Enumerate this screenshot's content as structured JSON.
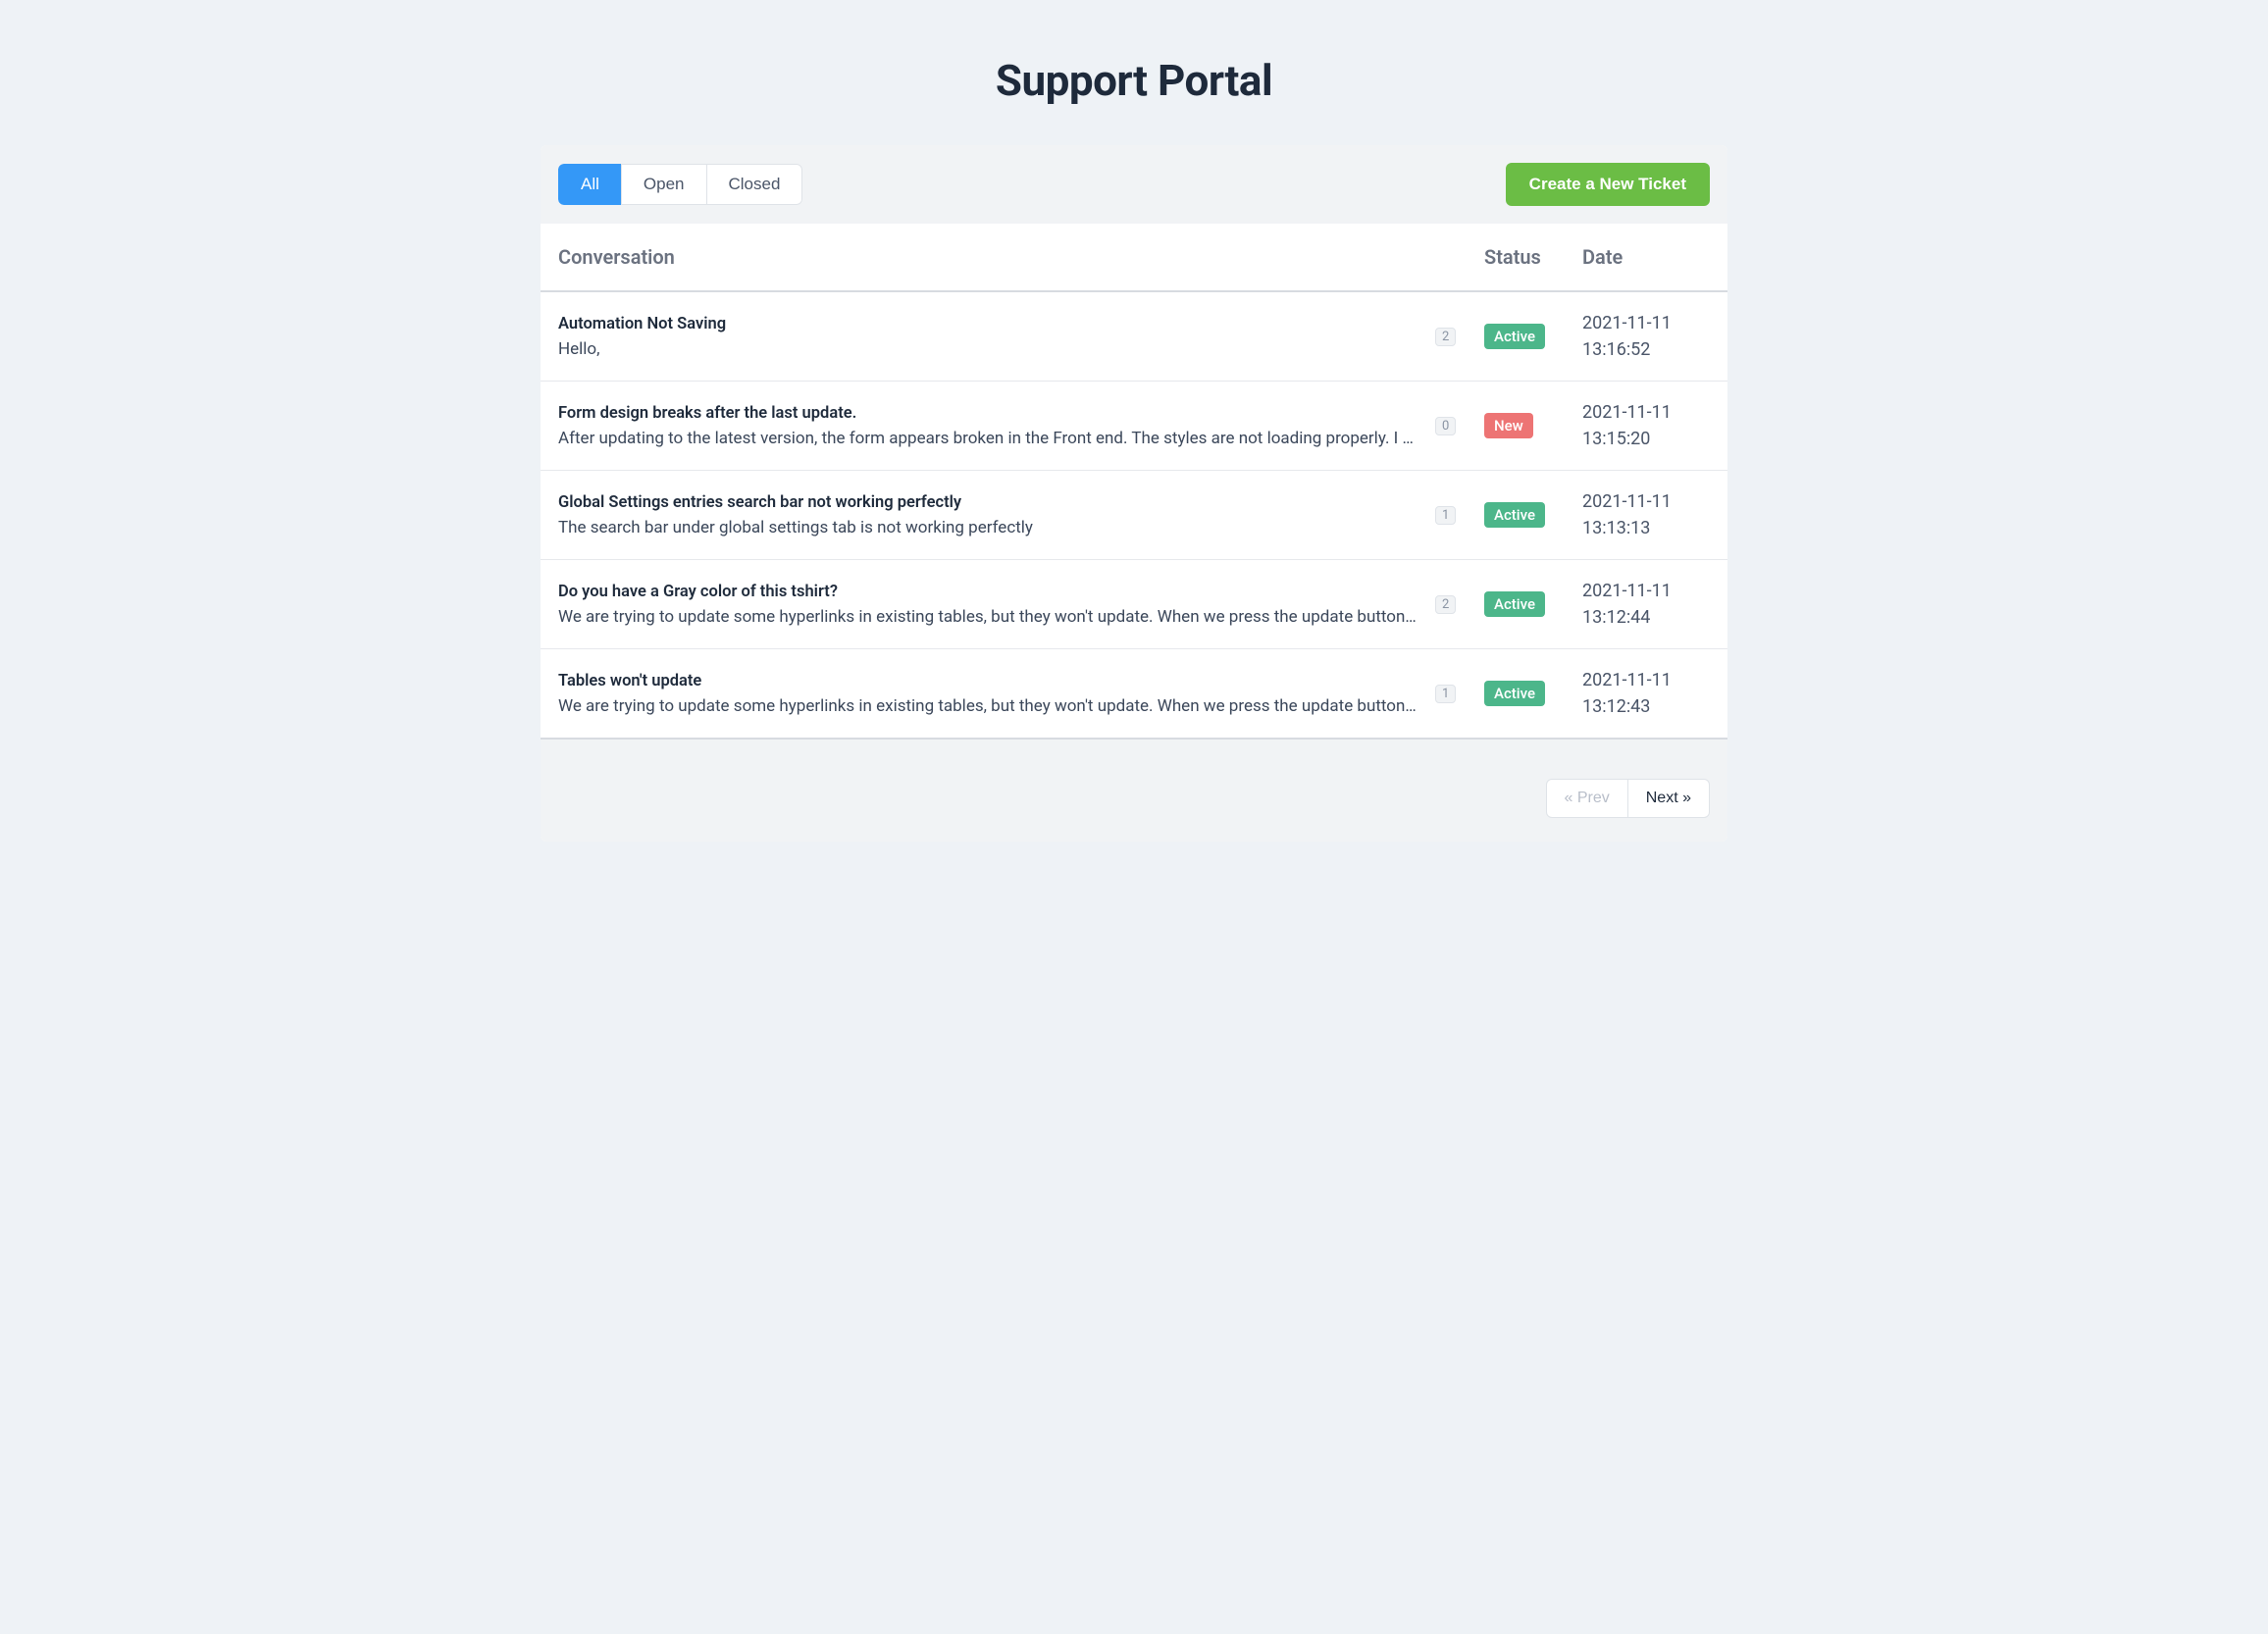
{
  "header": {
    "title": "Support Portal"
  },
  "toolbar": {
    "tabs": [
      {
        "label": "All",
        "active": true
      },
      {
        "label": "Open",
        "active": false
      },
      {
        "label": "Closed",
        "active": false
      }
    ],
    "create_button": "Create a New Ticket"
  },
  "columns": {
    "conversation": "Conversation",
    "status": "Status",
    "date": "Date"
  },
  "tickets": [
    {
      "title": "Automation Not Saving",
      "excerpt": "Hello,",
      "count": "2",
      "status": "Active",
      "status_kind": "active",
      "date": "2021-11-11 13:16:52"
    },
    {
      "title": "Form design breaks after the last update.",
      "excerpt": "After updating to the latest version, the form appears broken in the Front end. The styles are not loading properly. I am",
      "count": "0",
      "status": "New",
      "status_kind": "new",
      "date": "2021-11-11 13:15:20"
    },
    {
      "title": "Global Settings entries search bar not working perfectly",
      "excerpt": "The search bar under global settings tab is not working perfectly",
      "count": "1",
      "status": "Active",
      "status_kind": "active",
      "date": "2021-11-11 13:13:13"
    },
    {
      "title": "Do you have a Gray color of this tshirt?",
      "excerpt": "We are trying to update some hyperlinks in existing tables, but they won't update. When we press the update button, it",
      "count": "2",
      "status": "Active",
      "status_kind": "active",
      "date": "2021-11-11 13:12:44"
    },
    {
      "title": "Tables won't update",
      "excerpt": "We are trying to update some hyperlinks in existing tables, but they won't update. When we press the update button, it",
      "count": "1",
      "status": "Active",
      "status_kind": "active",
      "date": "2021-11-11 13:12:43"
    }
  ],
  "pager": {
    "prev": "« Prev",
    "next": "Next »",
    "prev_disabled": true,
    "next_disabled": false
  }
}
